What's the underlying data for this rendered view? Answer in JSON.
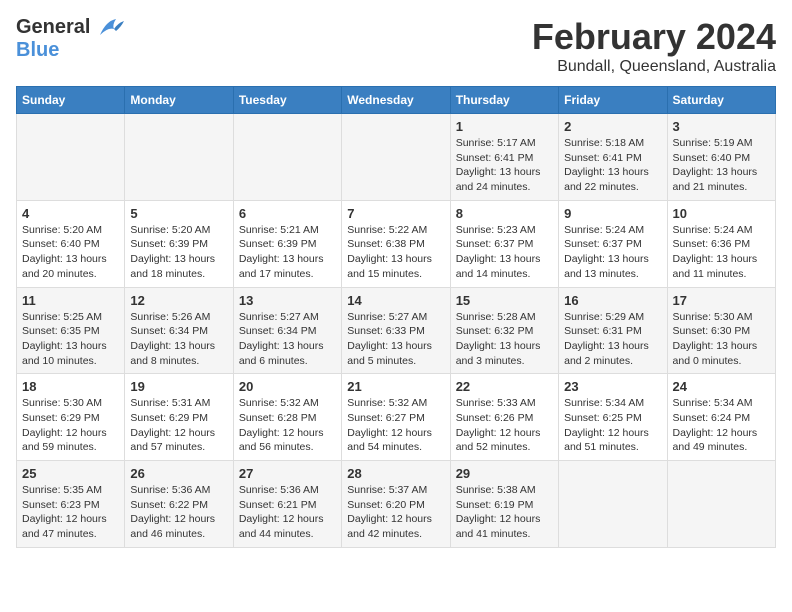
{
  "logo": {
    "general": "General",
    "blue": "Blue"
  },
  "title": "February 2024",
  "subtitle": "Bundall, Queensland, Australia",
  "days_of_week": [
    "Sunday",
    "Monday",
    "Tuesday",
    "Wednesday",
    "Thursday",
    "Friday",
    "Saturday"
  ],
  "weeks": [
    [
      {
        "day": "",
        "info": ""
      },
      {
        "day": "",
        "info": ""
      },
      {
        "day": "",
        "info": ""
      },
      {
        "day": "",
        "info": ""
      },
      {
        "day": "1",
        "info": "Sunrise: 5:17 AM\nSunset: 6:41 PM\nDaylight: 13 hours\nand 24 minutes."
      },
      {
        "day": "2",
        "info": "Sunrise: 5:18 AM\nSunset: 6:41 PM\nDaylight: 13 hours\nand 22 minutes."
      },
      {
        "day": "3",
        "info": "Sunrise: 5:19 AM\nSunset: 6:40 PM\nDaylight: 13 hours\nand 21 minutes."
      }
    ],
    [
      {
        "day": "4",
        "info": "Sunrise: 5:20 AM\nSunset: 6:40 PM\nDaylight: 13 hours\nand 20 minutes."
      },
      {
        "day": "5",
        "info": "Sunrise: 5:20 AM\nSunset: 6:39 PM\nDaylight: 13 hours\nand 18 minutes."
      },
      {
        "day": "6",
        "info": "Sunrise: 5:21 AM\nSunset: 6:39 PM\nDaylight: 13 hours\nand 17 minutes."
      },
      {
        "day": "7",
        "info": "Sunrise: 5:22 AM\nSunset: 6:38 PM\nDaylight: 13 hours\nand 15 minutes."
      },
      {
        "day": "8",
        "info": "Sunrise: 5:23 AM\nSunset: 6:37 PM\nDaylight: 13 hours\nand 14 minutes."
      },
      {
        "day": "9",
        "info": "Sunrise: 5:24 AM\nSunset: 6:37 PM\nDaylight: 13 hours\nand 13 minutes."
      },
      {
        "day": "10",
        "info": "Sunrise: 5:24 AM\nSunset: 6:36 PM\nDaylight: 13 hours\nand 11 minutes."
      }
    ],
    [
      {
        "day": "11",
        "info": "Sunrise: 5:25 AM\nSunset: 6:35 PM\nDaylight: 13 hours\nand 10 minutes."
      },
      {
        "day": "12",
        "info": "Sunrise: 5:26 AM\nSunset: 6:34 PM\nDaylight: 13 hours\nand 8 minutes."
      },
      {
        "day": "13",
        "info": "Sunrise: 5:27 AM\nSunset: 6:34 PM\nDaylight: 13 hours\nand 6 minutes."
      },
      {
        "day": "14",
        "info": "Sunrise: 5:27 AM\nSunset: 6:33 PM\nDaylight: 13 hours\nand 5 minutes."
      },
      {
        "day": "15",
        "info": "Sunrise: 5:28 AM\nSunset: 6:32 PM\nDaylight: 13 hours\nand 3 minutes."
      },
      {
        "day": "16",
        "info": "Sunrise: 5:29 AM\nSunset: 6:31 PM\nDaylight: 13 hours\nand 2 minutes."
      },
      {
        "day": "17",
        "info": "Sunrise: 5:30 AM\nSunset: 6:30 PM\nDaylight: 13 hours\nand 0 minutes."
      }
    ],
    [
      {
        "day": "18",
        "info": "Sunrise: 5:30 AM\nSunset: 6:29 PM\nDaylight: 12 hours\nand 59 minutes."
      },
      {
        "day": "19",
        "info": "Sunrise: 5:31 AM\nSunset: 6:29 PM\nDaylight: 12 hours\nand 57 minutes."
      },
      {
        "day": "20",
        "info": "Sunrise: 5:32 AM\nSunset: 6:28 PM\nDaylight: 12 hours\nand 56 minutes."
      },
      {
        "day": "21",
        "info": "Sunrise: 5:32 AM\nSunset: 6:27 PM\nDaylight: 12 hours\nand 54 minutes."
      },
      {
        "day": "22",
        "info": "Sunrise: 5:33 AM\nSunset: 6:26 PM\nDaylight: 12 hours\nand 52 minutes."
      },
      {
        "day": "23",
        "info": "Sunrise: 5:34 AM\nSunset: 6:25 PM\nDaylight: 12 hours\nand 51 minutes."
      },
      {
        "day": "24",
        "info": "Sunrise: 5:34 AM\nSunset: 6:24 PM\nDaylight: 12 hours\nand 49 minutes."
      }
    ],
    [
      {
        "day": "25",
        "info": "Sunrise: 5:35 AM\nSunset: 6:23 PM\nDaylight: 12 hours\nand 47 minutes."
      },
      {
        "day": "26",
        "info": "Sunrise: 5:36 AM\nSunset: 6:22 PM\nDaylight: 12 hours\nand 46 minutes."
      },
      {
        "day": "27",
        "info": "Sunrise: 5:36 AM\nSunset: 6:21 PM\nDaylight: 12 hours\nand 44 minutes."
      },
      {
        "day": "28",
        "info": "Sunrise: 5:37 AM\nSunset: 6:20 PM\nDaylight: 12 hours\nand 42 minutes."
      },
      {
        "day": "29",
        "info": "Sunrise: 5:38 AM\nSunset: 6:19 PM\nDaylight: 12 hours\nand 41 minutes."
      },
      {
        "day": "",
        "info": ""
      },
      {
        "day": "",
        "info": ""
      }
    ]
  ]
}
